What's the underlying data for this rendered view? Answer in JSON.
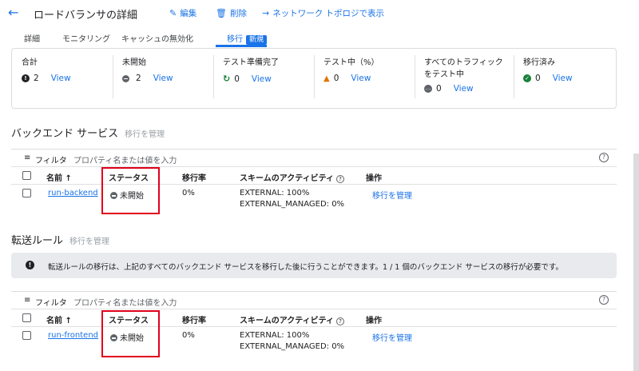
{
  "header": {
    "title": "ロードバランサの詳細",
    "edit_label": "編集",
    "delete_label": "削除",
    "topology_label": "ネットワーク トポロジで表示"
  },
  "tabs": [
    {
      "label": "詳細"
    },
    {
      "label": "モニタリング"
    },
    {
      "label": "キャッシュの無効化"
    },
    {
      "label": "移行",
      "badge": "新規"
    }
  ],
  "summary": [
    {
      "label": "合計",
      "count": "2",
      "view": "View",
      "icon": "info-icon"
    },
    {
      "label": "未開始",
      "count": "2",
      "view": "View",
      "icon": "not-started-icon"
    },
    {
      "label": "テスト準備完了",
      "count": "0",
      "view": "View",
      "icon": "refresh-green-icon"
    },
    {
      "label": "テスト中（%）",
      "count": "0",
      "view": "View",
      "icon": "warning-icon"
    },
    {
      "label": "すべてのトラフィック",
      "label2": "をテスト中",
      "count": "0",
      "view": "View",
      "icon": "more-icon"
    },
    {
      "label": "移行済み",
      "count": "0",
      "view": "View",
      "icon": "check-icon"
    }
  ],
  "backend": {
    "title": "バックエンド サービス",
    "subtitle": "移行を管理",
    "filter_label": "フィルタ",
    "filter_placeholder": "プロパティ名または値を入力",
    "columns": {
      "name": "名前",
      "status": "ステータス",
      "rate": "移行率",
      "scheme": "スキームのアクティビティ",
      "action": "操作"
    },
    "row": {
      "name": "run-backend",
      "status": "未開始",
      "rate": "0%",
      "scheme1": "EXTERNAL: 100%",
      "scheme2": "EXTERNAL_MANAGED: 0%",
      "action": "移行を管理"
    }
  },
  "forwarding": {
    "title": "転送ルール",
    "subtitle": "移行を管理",
    "info": "転送ルールの移行は、上記のすべてのバックエンド サービスを移行した後に行うことができます。1 / 1 個のバックエンド サービスの移行が必要です。",
    "filter_label": "フィルタ",
    "filter_placeholder": "プロパティ名または値を入力",
    "columns": {
      "name": "名前",
      "status": "ステータス",
      "rate": "移行率",
      "scheme": "スキームのアクティビティ",
      "action": "操作"
    },
    "row": {
      "name": "run-frontend",
      "status": "未開始",
      "rate": "0%",
      "scheme1": "EXTERNAL: 100%",
      "scheme2": "EXTERNAL_MANAGED: 0%",
      "action": "移行を管理"
    }
  }
}
